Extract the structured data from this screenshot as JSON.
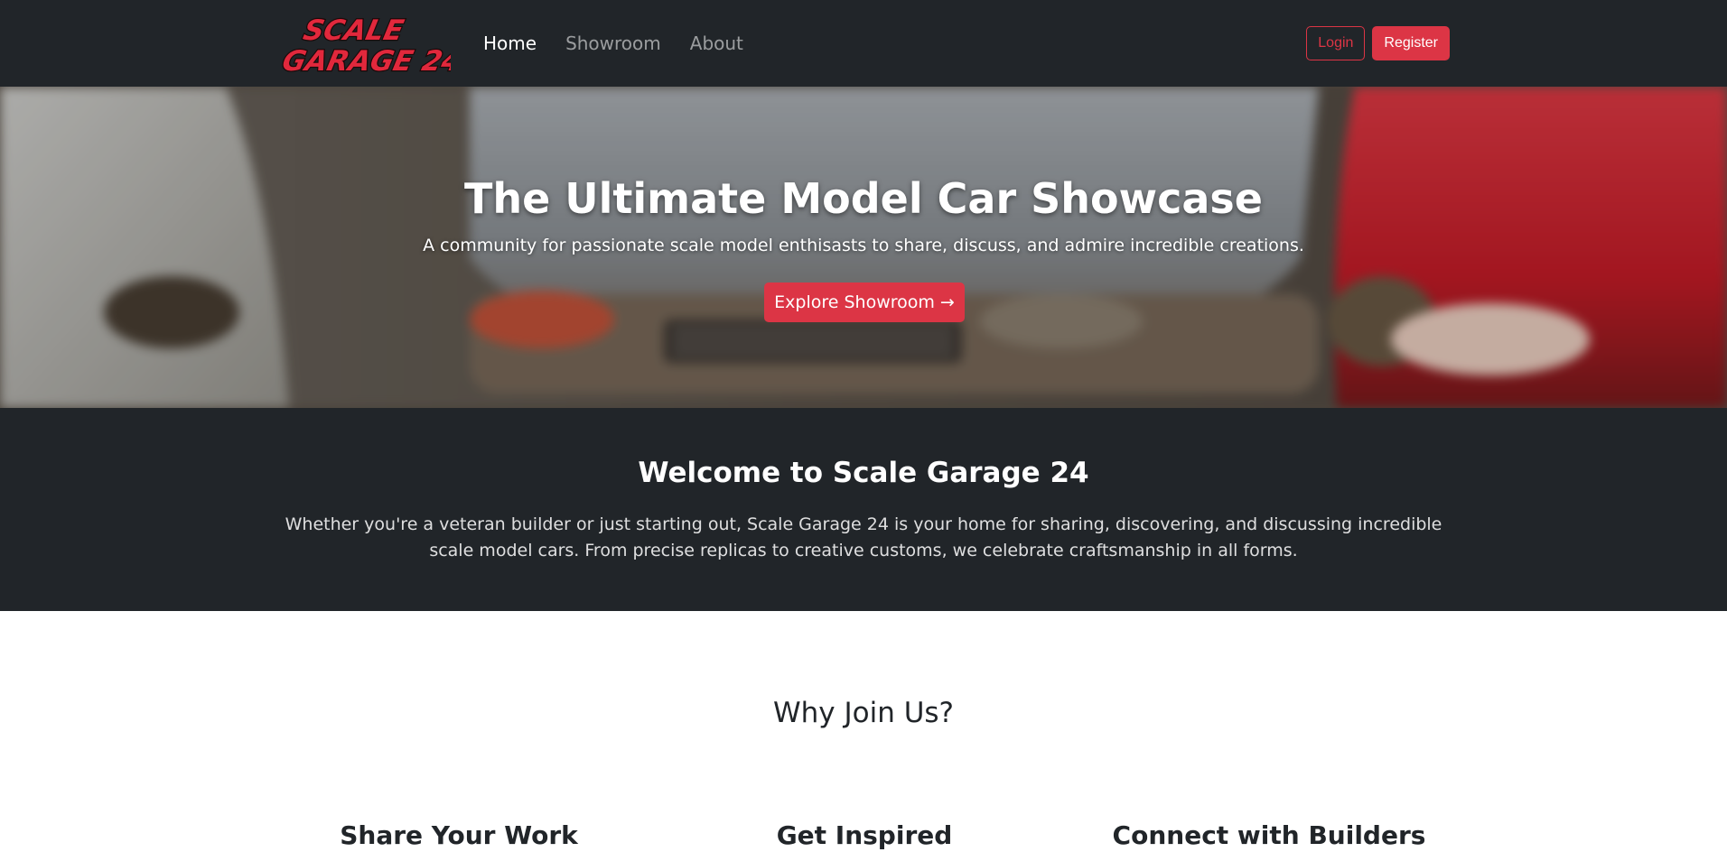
{
  "brand": {
    "logo_line1": "SCALE",
    "logo_line2": "GARAGE 24"
  },
  "nav": {
    "links": [
      {
        "label": "Home",
        "active": true
      },
      {
        "label": "Showroom",
        "active": false
      },
      {
        "label": "About",
        "active": false
      }
    ],
    "login_label": "Login",
    "register_label": "Register"
  },
  "hero": {
    "title": "The Ultimate Model Car Showcase",
    "subtitle": "A community for passionate scale model enthisasts to share, discuss, and admire incredible creations.",
    "cta_label": "Explore Showroom →"
  },
  "welcome": {
    "title": "Welcome to Scale Garage 24",
    "text": "Whether you're a veteran builder or just starting out, Scale Garage 24 is your home for sharing, discovering, and discussing incredible scale model cars. From precise replicas to creative customs, we celebrate craftsmanship in all forms."
  },
  "why": {
    "title": "Why Join Us?",
    "features": [
      {
        "title": "Share Your Work"
      },
      {
        "title": "Get Inspired"
      },
      {
        "title": "Connect with Builders"
      }
    ]
  },
  "colors": {
    "accent": "#dc3545",
    "dark": "#212529"
  }
}
